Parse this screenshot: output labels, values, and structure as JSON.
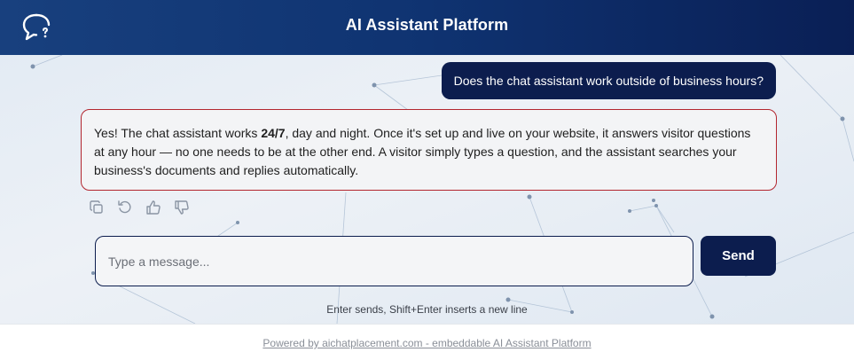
{
  "header": {
    "title": "AI Assistant Platform",
    "logo_icon": "chat-question-icon"
  },
  "messages": {
    "user": "Does the chat assistant work outside of business hours?",
    "bot": {
      "part1": "Yes! The chat assistant works ",
      "bold": "24/7",
      "part2": ", day and night. Once it's set up and live on your website, it answers visitor questions at any hour — no one needs to be at the other end. A visitor simply types a question, and the assistant searches your business's documents and replies automatically."
    },
    "actions": [
      "copy-icon",
      "regenerate-icon",
      "thumbs-up-icon",
      "thumbs-down-icon"
    ]
  },
  "composer": {
    "placeholder": "Type a message...",
    "value": "",
    "send_label": "Send",
    "hint": "Enter sends, Shift+Enter inserts a new line"
  },
  "footer": {
    "link_text": "Powered by aichatplacement.com - embeddable AI Assistant Platform"
  },
  "colors": {
    "brand_navy": "#0c1d4e",
    "header_start": "#18407e",
    "bot_border": "#b3262f"
  }
}
